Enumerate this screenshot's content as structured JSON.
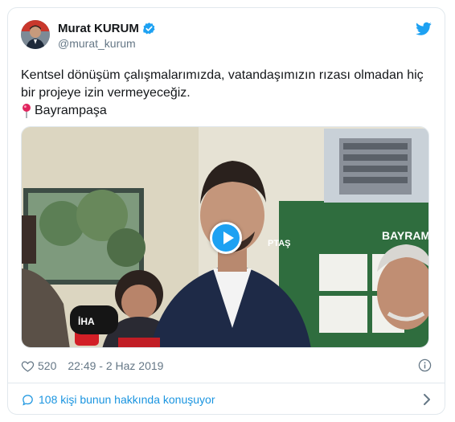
{
  "tweet": {
    "author": {
      "display_name": "Murat KURUM",
      "handle": "@murat_kurum",
      "verified": true
    },
    "text_line": "Kentsel dönüşüm çalışmalarımızda, vatandaşımızın rızası olmadan hiç bir projeye izin vermeyeceğiz.",
    "location_emoji": "📍",
    "location": "Bayrampaşa",
    "media": {
      "type": "video",
      "sign_text": "BAYRAMP",
      "logo_text": "PTAŞ",
      "mic_label": "İHA"
    },
    "likes": "520",
    "timestamp": "22:49 - 2 Haz 2019",
    "conversation_link": "108 kişi bunun hakkında konuşuyor"
  },
  "colors": {
    "brand": "#1da1f2",
    "link": "#1b95e0",
    "secondary_text": "#657786",
    "border": "#e1e8ed"
  },
  "icons": [
    "verified-icon",
    "twitter-icon",
    "pin-icon",
    "play-icon",
    "heart-icon",
    "info-icon",
    "reply-icon",
    "chevron-right-icon"
  ]
}
